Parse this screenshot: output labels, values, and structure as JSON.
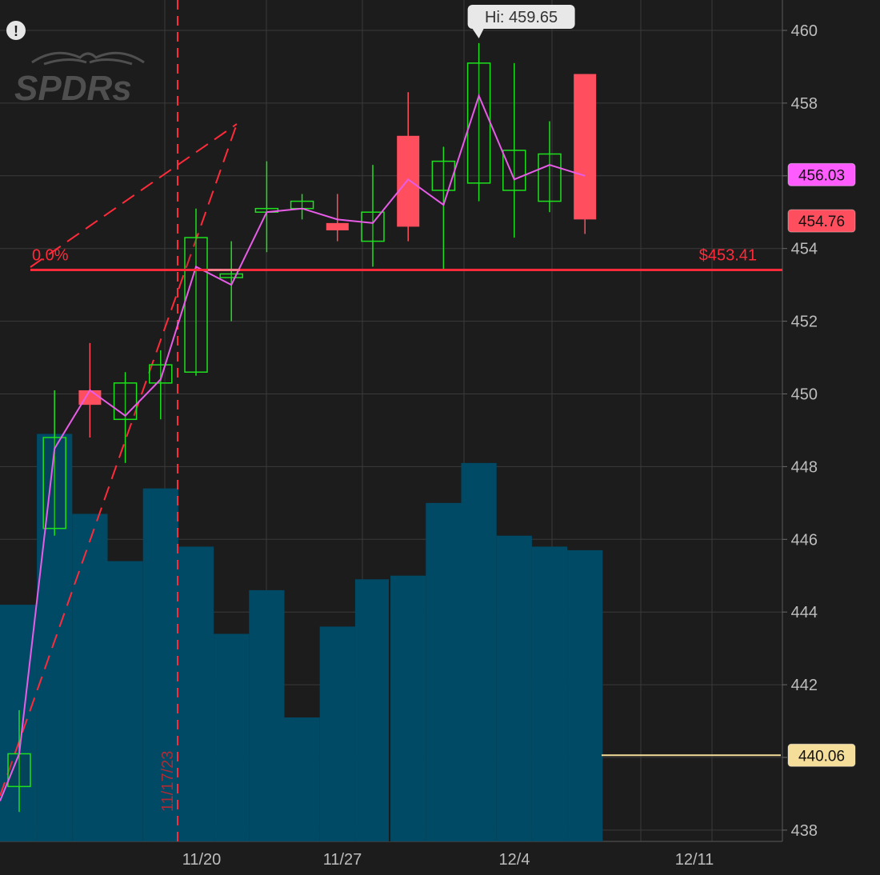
{
  "chart_data": {
    "type": "candlestick",
    "y_range": [
      437.6,
      460.6
    ],
    "y_ticks": [
      "438",
      "440",
      "442",
      "444",
      "446",
      "448",
      "450",
      "452",
      "454",
      "456",
      "458",
      "460"
    ],
    "x_tick_labels": [
      "11/20",
      "11/27",
      "12/4",
      "12/11"
    ],
    "candles": [
      {
        "open": 439.2,
        "high": 441.3,
        "low": 438.5,
        "close": 440.1,
        "volume": 444.2,
        "dir": "up"
      },
      {
        "open": 446.3,
        "high": 450.1,
        "low": 446.1,
        "close": 448.8,
        "volume": 448.9,
        "dir": "up"
      },
      {
        "open": 450.1,
        "high": 451.4,
        "low": 448.8,
        "close": 449.7,
        "volume": 446.7,
        "dir": "down"
      },
      {
        "open": 449.3,
        "high": 450.6,
        "low": 448.1,
        "close": 450.3,
        "volume": 445.4,
        "dir": "up"
      },
      {
        "open": 450.3,
        "high": 451.2,
        "low": 449.3,
        "close": 450.8,
        "volume": 447.4,
        "dir": "up"
      },
      {
        "open": 450.6,
        "high": 455.1,
        "low": 450.5,
        "close": 454.3,
        "volume": 445.8,
        "dir": "up"
      },
      {
        "open": 453.2,
        "high": 454.2,
        "low": 452.0,
        "close": 453.3,
        "volume": 443.4,
        "dir": "up"
      },
      {
        "open": 455.0,
        "high": 456.4,
        "low": 453.9,
        "close": 455.1,
        "volume": 444.6,
        "dir": "up"
      },
      {
        "open": 455.1,
        "high": 455.5,
        "low": 454.8,
        "close": 455.3,
        "volume": 441.1,
        "dir": "up"
      },
      {
        "open": 454.7,
        "high": 455.5,
        "low": 454.2,
        "close": 454.5,
        "volume": 443.6,
        "dir": "down"
      },
      {
        "open": 454.2,
        "high": 456.3,
        "low": 453.5,
        "close": 455.0,
        "volume": 444.9,
        "dir": "up"
      },
      {
        "open": 457.1,
        "high": 458.3,
        "low": 454.2,
        "close": 454.6,
        "volume": 445.0,
        "dir": "down"
      },
      {
        "open": 455.6,
        "high": 456.8,
        "low": 453.4,
        "close": 456.4,
        "volume": 447.0,
        "dir": "up"
      },
      {
        "open": 455.8,
        "high": 459.65,
        "low": 455.3,
        "close": 459.1,
        "volume": 448.1,
        "dir": "up"
      },
      {
        "open": 455.6,
        "high": 459.1,
        "low": 454.3,
        "close": 456.7,
        "volume": 446.1,
        "dir": "up"
      },
      {
        "open": 455.3,
        "high": 457.5,
        "low": 455.0,
        "close": 456.6,
        "volume": 445.8,
        "dir": "up"
      },
      {
        "open": 458.8,
        "high": 458.8,
        "low": 454.4,
        "close": 454.8,
        "volume": 445.7,
        "dir": "down"
      }
    ],
    "moving_average": [
      440.1,
      448.5,
      450.1,
      449.4,
      450.4,
      453.5,
      453.0,
      455.0,
      455.1,
      454.8,
      454.7,
      455.9,
      455.2,
      458.2,
      455.9,
      456.3,
      456.0
    ],
    "hline_price": 453.41,
    "hline_label": "$453.41",
    "fib_label": "0.0%",
    "vline_label": "11/17/23",
    "hi_label": "Hi: 459.65",
    "hi_value": 459.65,
    "badges": [
      {
        "text": "456.03",
        "value": 456.03,
        "bg": "#ff5cff",
        "fg": "#111111"
      },
      {
        "text": "454.76",
        "value": 454.76,
        "bg": "#ff4f5e",
        "fg": "#111111"
      },
      {
        "text": "440.06",
        "value": 440.06,
        "bg": "#f5dd9a",
        "fg": "#111111"
      }
    ],
    "colors": {
      "background": "#1c1c1c",
      "grid": "#3a3a3a",
      "up": "#1ee01e",
      "down": "#ff4f5e",
      "volume": "#004a66",
      "ma": "#e85ce8",
      "hline": "#ff2a3a",
      "trendline": "#ff2a3a",
      "level_line": "#f5dd9a",
      "logo": "#7a7a7a"
    }
  },
  "logo_text": "SPDRs",
  "alert_glyph": "!"
}
